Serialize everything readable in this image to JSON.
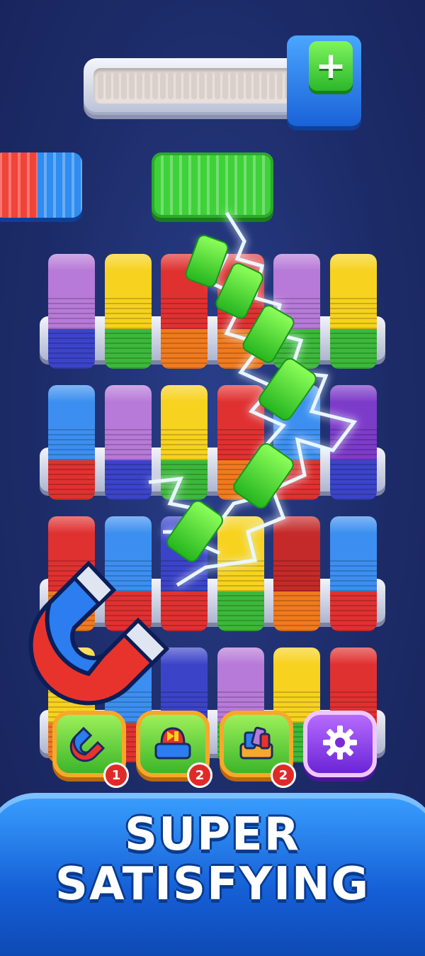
{
  "hud": {
    "progress_fraction": 0.0,
    "add_button_label": "+"
  },
  "top_boxes": [
    {
      "colors": [
        "#f0433a",
        "#2f8cf0"
      ]
    },
    {
      "colors": [
        "#3fd13a"
      ]
    }
  ],
  "shelves": [
    {
      "columns": [
        [
          "#b77ad8",
          "#b77ad8",
          "#3b44c9"
        ],
        [
          "#f7d21e",
          "#f7d21e",
          "#3cb83a"
        ],
        [
          "#e03131",
          "#e03131",
          "#f07a1e"
        ],
        [
          "#e03131",
          "#e03131",
          "#f07a1e"
        ],
        [
          "#b77ad8",
          "#b77ad8",
          "#3cb83a"
        ],
        [
          "#f7d21e",
          "#f7d21e",
          "#3cb83a"
        ]
      ]
    },
    {
      "columns": [
        [
          "#3c8ff0",
          "#3c8ff0",
          "#e03131"
        ],
        [
          "#b77ad8",
          "#b77ad8",
          "#3b44c9"
        ],
        [
          "#f7d21e",
          "#f7d21e",
          "#3cb83a"
        ],
        [
          "#e03131",
          "#e03131",
          "#f07a1e"
        ],
        [
          "#3c8ff0",
          "#3c8ff0",
          "#e03131"
        ],
        [
          "#7d3bc9",
          "#7d3bc9",
          "#3b44c9"
        ]
      ]
    },
    {
      "columns": [
        [
          "#e03131",
          "#e03131",
          "#f07a1e"
        ],
        [
          "#3c8ff0",
          "#3c8ff0",
          "#e03131"
        ],
        [
          "#3b44c9",
          "#3b44c9",
          "#e03131"
        ],
        [
          "#f7d21e",
          "#f7d21e",
          "#3cb83a"
        ],
        [
          "#c42a2a",
          "#c42a2a",
          "#f07a1e"
        ],
        [
          "#3c8ff0",
          "#3c8ff0",
          "#e03131"
        ]
      ]
    },
    {
      "columns": [
        [
          "#f7d21e",
          "#f7d21e",
          "#f07a1e"
        ],
        [
          "#3c8ff0",
          "#3c8ff0",
          "#e03131"
        ],
        [
          "#3b44c9",
          "#3b44c9",
          "#3cb83a"
        ],
        [
          "#b77ad8",
          "#b77ad8",
          "#3cb83a"
        ],
        [
          "#f7d21e",
          "#f7d21e",
          "#3cb83a"
        ],
        [
          "#e03131",
          "#e03131",
          "#f07a1e"
        ]
      ]
    }
  ],
  "powerups": [
    {
      "icon": "magnet-icon",
      "count": "1"
    },
    {
      "icon": "skip-icon",
      "count": "2"
    },
    {
      "icon": "shuffle-blocks-icon",
      "count": "2"
    },
    {
      "icon": "settings-gear-icon",
      "count": ""
    }
  ],
  "banner": {
    "line1": "SUPER",
    "line2": "SATISFYING"
  }
}
